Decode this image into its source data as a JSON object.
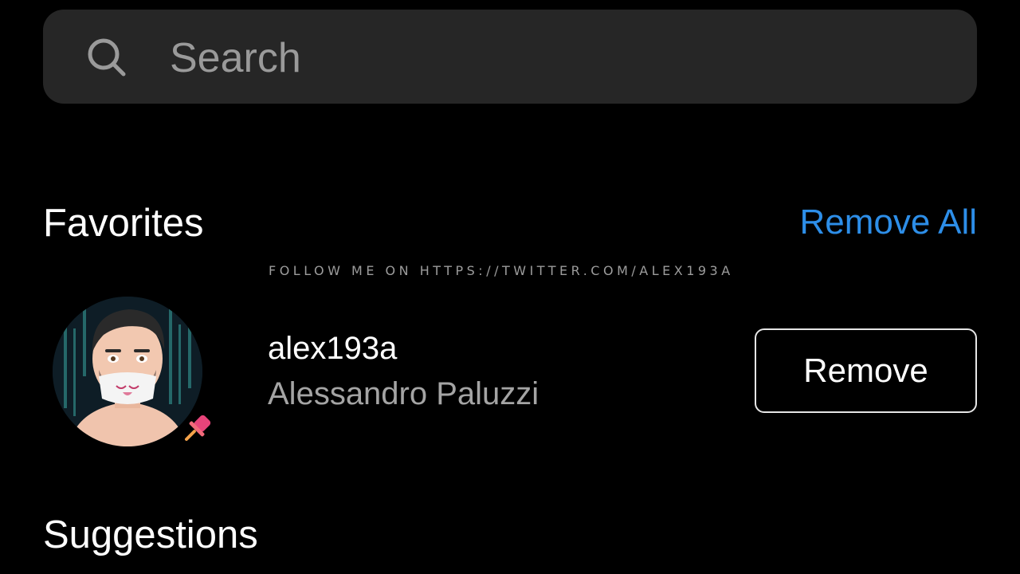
{
  "search": {
    "placeholder": "Search",
    "icon": "search-icon"
  },
  "favorites": {
    "title": "Favorites",
    "remove_all_label": "Remove All",
    "items": [
      {
        "username": "alex193a",
        "full_name": "Alessandro Paluzzi",
        "remove_label": "Remove",
        "badge_icon": "pin-icon"
      }
    ]
  },
  "watermark": "FOLLOW ME ON HTTPS://TWITTER.COM/ALEX193A",
  "suggestions": {
    "title": "Suggestions"
  },
  "colors": {
    "background": "#000000",
    "search_bg": "#262626",
    "accent": "#2d8ee8",
    "secondary_text": "#a4a4a4"
  }
}
